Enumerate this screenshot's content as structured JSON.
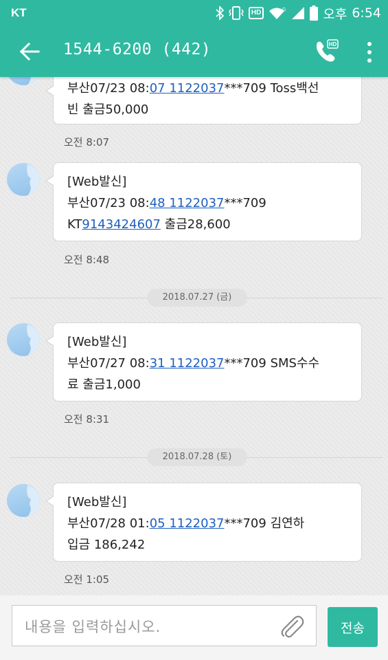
{
  "status_bar": {
    "carrier": "KT",
    "hd_badge": "HD",
    "ampm": "오후",
    "time": "6:54",
    "icons": [
      "bluetooth-icon",
      "vibrate-icon",
      "hd-voice-icon",
      "wifi-icon",
      "signal-icon",
      "battery-icon"
    ]
  },
  "app_bar": {
    "title": "1544-6200 (442)",
    "call_hd_badge": "HD",
    "icons": [
      "back-arrow-icon",
      "hd-call-icon",
      "more-vert-icon"
    ]
  },
  "messages": [
    {
      "line1_pre": "부산07/23 08:",
      "link1": "07 1122037",
      "line1_post": "***709 Toss백선",
      "line2": "빈 출금50,000",
      "time": "오전 8:07"
    },
    {
      "header": "[Web발신]",
      "line1_pre": "부산07/23 08:",
      "link1": "48 1122037",
      "line1_post": "***709",
      "line2_pre": "KT",
      "link2": "9143424607",
      "line2_post": " 출금28,600",
      "time": "오전 8:48"
    },
    {
      "date": "2018.07.27 (금)",
      "header": "[Web발신]",
      "line1_pre": "부산07/27 08:",
      "link1": "31 1122037",
      "line1_post": "***709 SMS수수",
      "line2": "료 출금1,000",
      "time": "오전 8:31"
    },
    {
      "date": "2018.07.28 (토)",
      "header": "[Web발신]",
      "line1_pre": "부산07/28 01:",
      "link1": "05 1122037",
      "line1_post": "***709 김연하",
      "line2": "입금 186,242",
      "time": "오전 1:05"
    }
  ],
  "composer": {
    "placeholder": "내용을 입력하십시오.",
    "send_label": "전송",
    "attach_icon": "paperclip-icon"
  },
  "colors": {
    "accent": "#2fb9a1",
    "link": "#1d5fbf",
    "background": "#ececec"
  }
}
